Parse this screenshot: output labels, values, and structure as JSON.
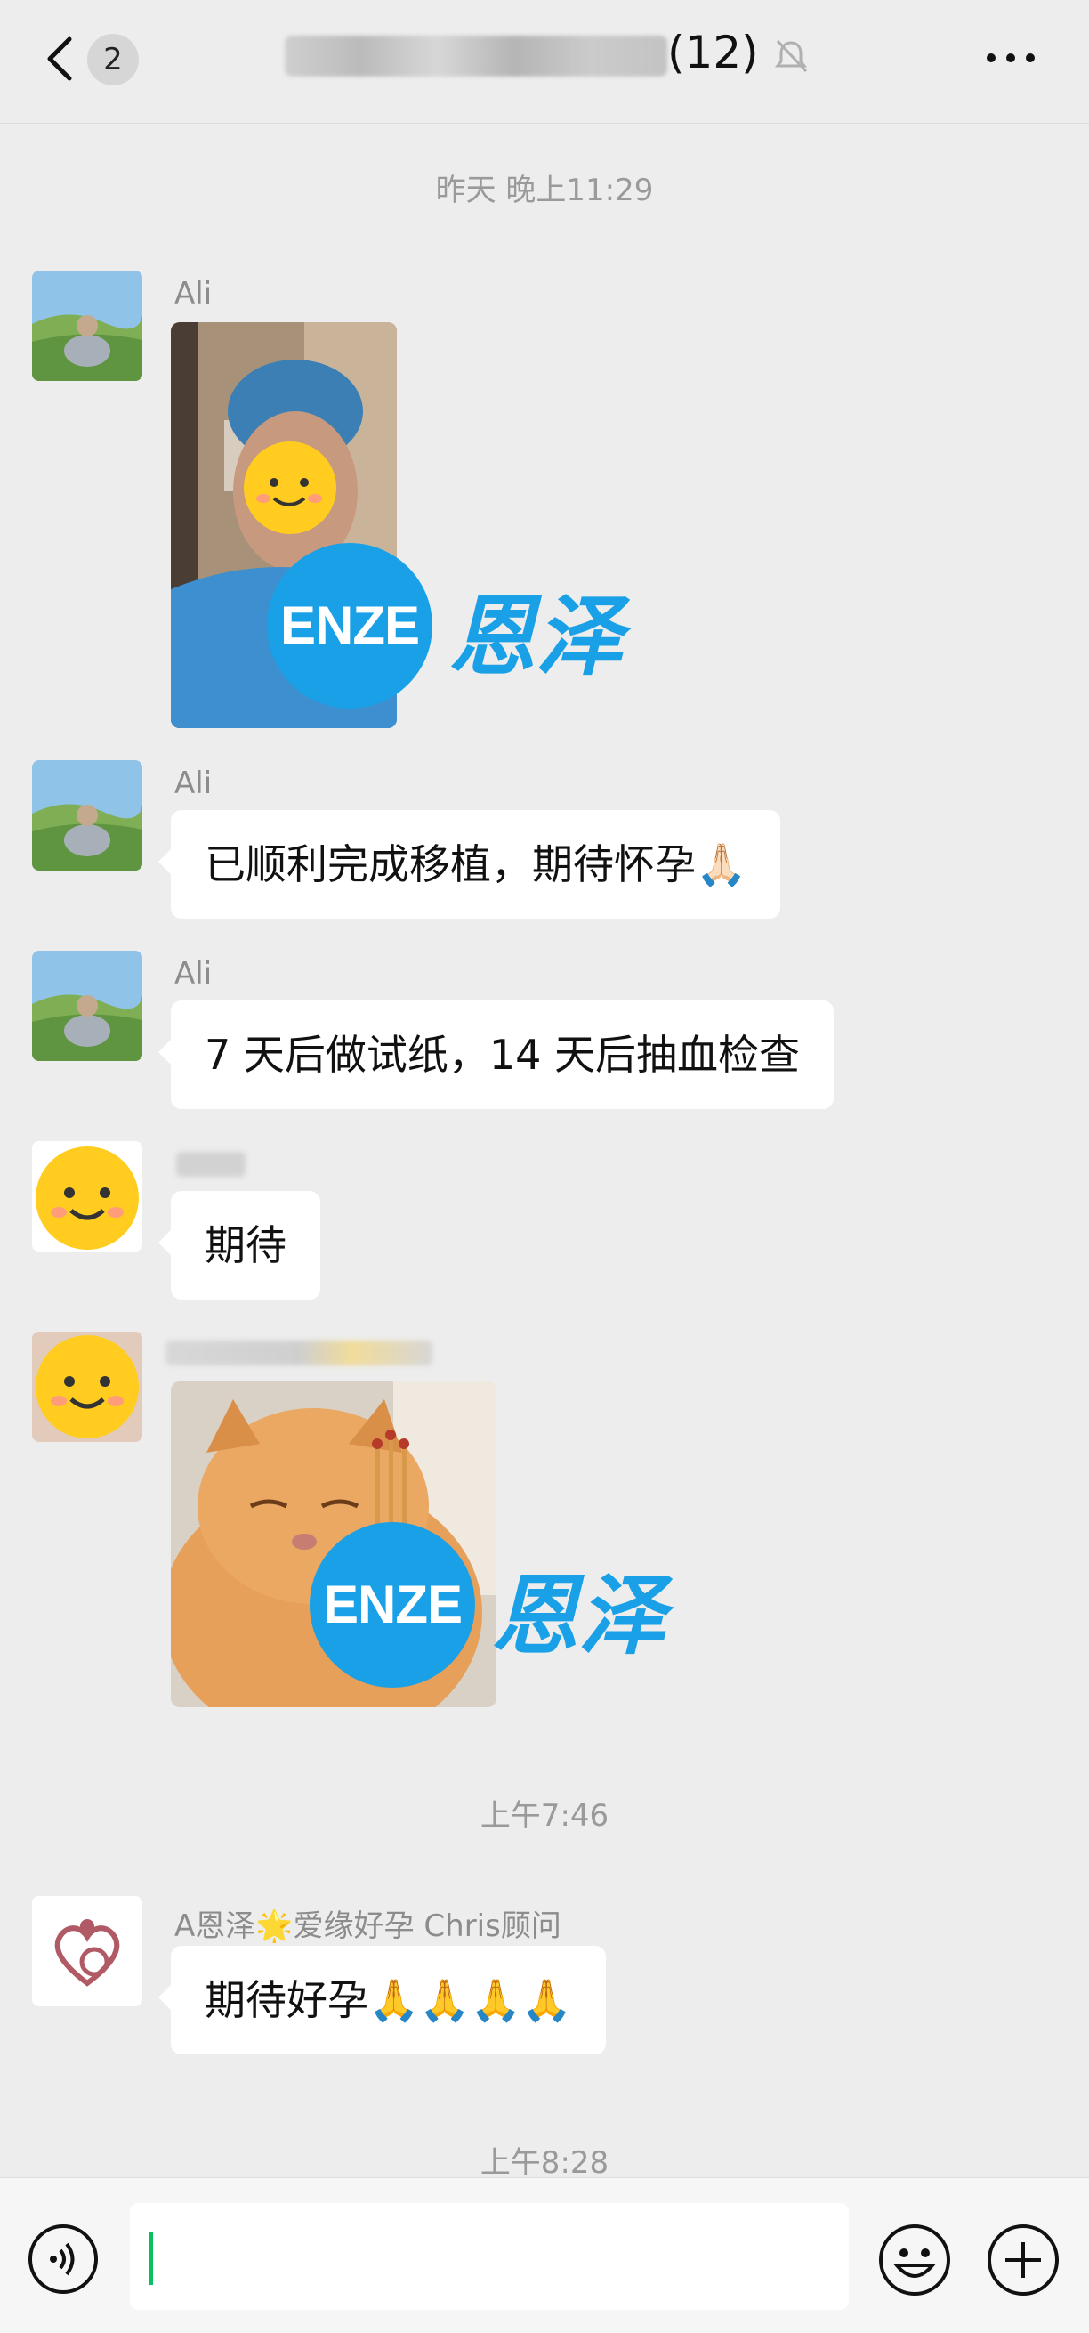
{
  "header": {
    "back_label": "返回",
    "unread_count": "2",
    "group_member_count": "(12)"
  },
  "messages": [
    {
      "type": "timestamp",
      "text": "昨天 晚上11:29"
    },
    {
      "sender": "Ali",
      "type": "image",
      "watermark": "ENZE",
      "watermark_cn": "恩泽"
    },
    {
      "sender": "Ali",
      "type": "text",
      "text": "已顺利完成移植，期待怀孕🙏🏻"
    },
    {
      "sender": "Ali",
      "type": "text",
      "text": "7 天后做试纸，14 天后抽血检查"
    },
    {
      "sender": "",
      "type": "text",
      "text": "期待"
    },
    {
      "sender": "",
      "type": "sticker",
      "watermark": "ENZE",
      "watermark_cn": "恩泽"
    },
    {
      "type": "timestamp",
      "text": "上午7:46"
    },
    {
      "sender": "A恩泽🌟爱缘好孕 Chris顾问",
      "type": "text",
      "text": "期待好孕🙏🙏🙏🙏"
    },
    {
      "type": "timestamp",
      "text": "上午8:28"
    }
  ],
  "input": {
    "value": ""
  },
  "icons": [
    "back-icon",
    "mute-bell-icon",
    "more-icon",
    "voice-icon",
    "emoji-icon",
    "plus-icon"
  ],
  "colors": {
    "accent": "#07c160",
    "watermark": "#1aa0e6",
    "background": "#ededed"
  }
}
